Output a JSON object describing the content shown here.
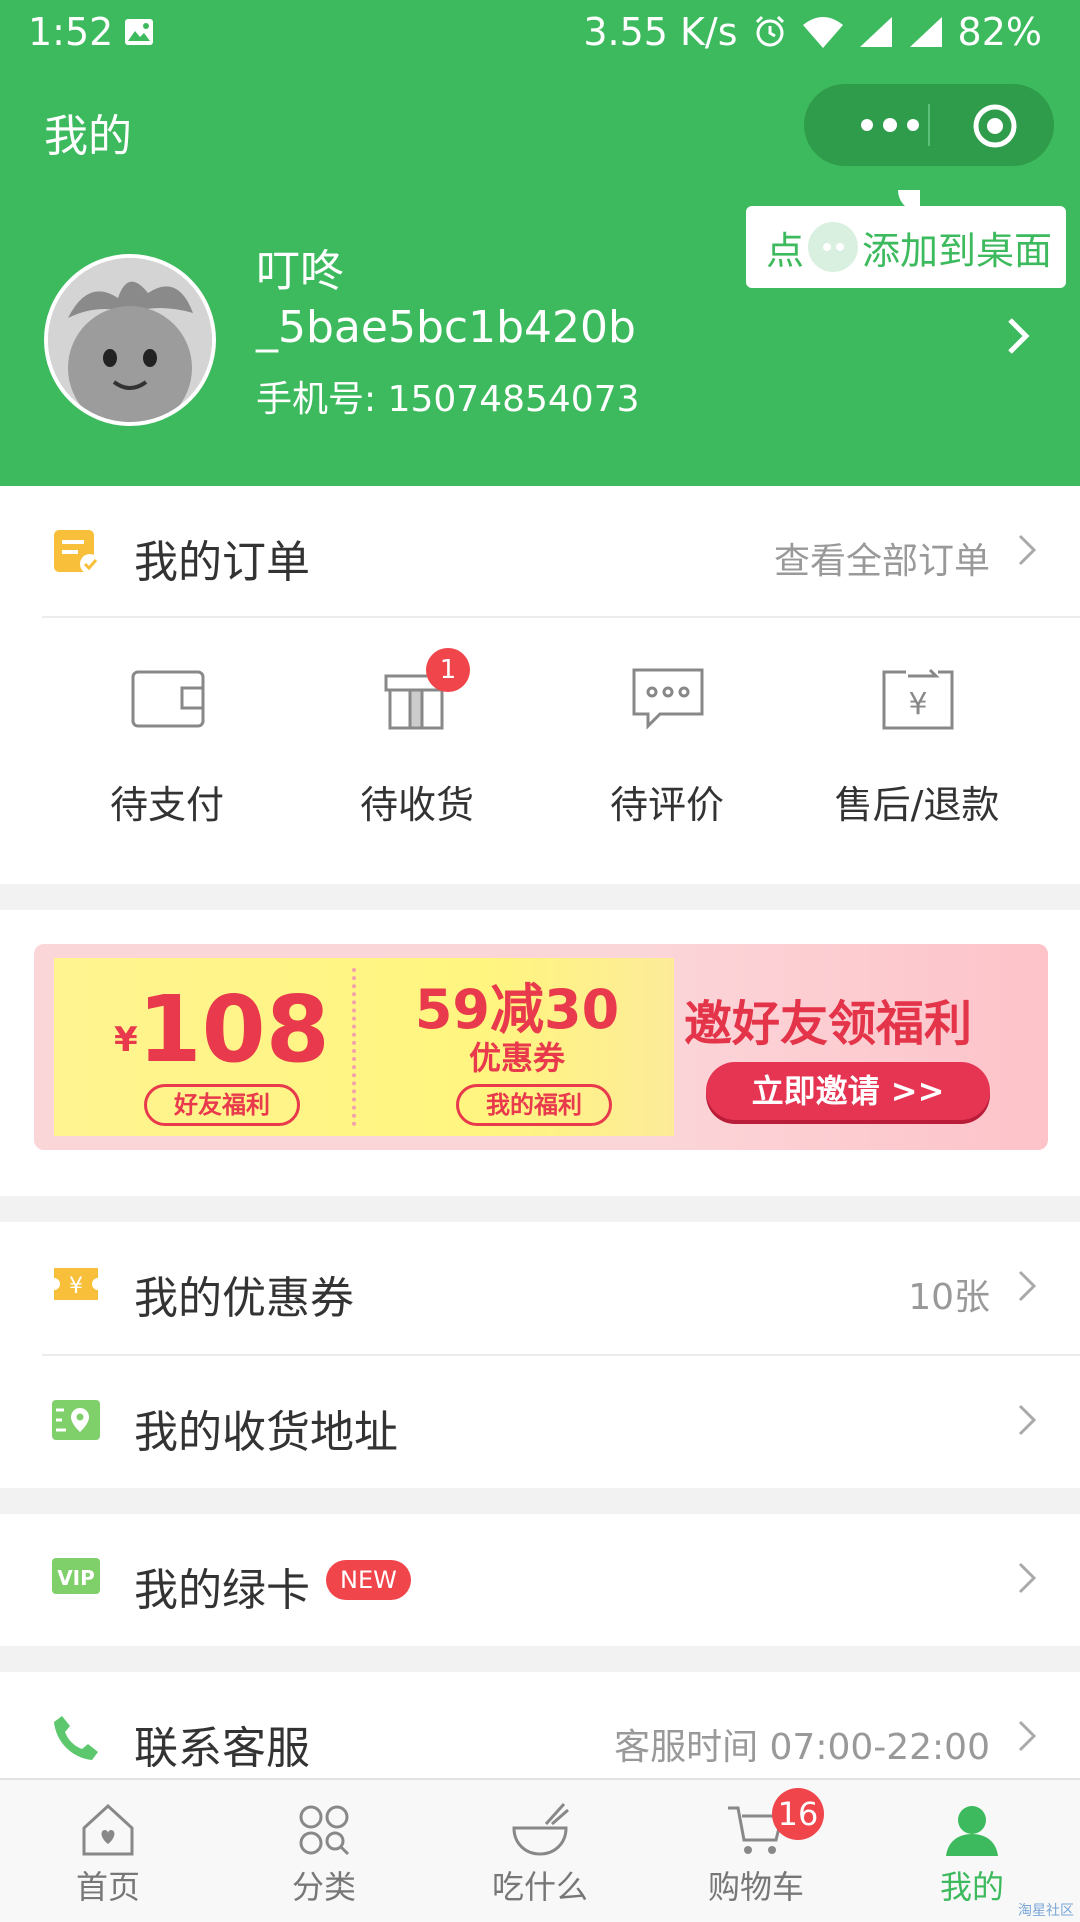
{
  "status_bar": {
    "time": "1:52",
    "net_speed": "3.55 K/s",
    "battery": "82%"
  },
  "header": {
    "title": "我的",
    "tip": {
      "prefix": "点",
      "suffix": "添加到桌面"
    },
    "user": {
      "name_line1": "叮咚",
      "name_line2": "_5bae5bc1b420b",
      "phone": "手机号: 15074854073"
    }
  },
  "orders": {
    "title": "我的订单",
    "view_all": "查看全部订单",
    "items": [
      {
        "label": "待支付",
        "icon": "wallet-icon"
      },
      {
        "label": "待收货",
        "icon": "package-icon",
        "badge": "1"
      },
      {
        "label": "待评价",
        "icon": "comment-icon"
      },
      {
        "label": "售后/退款",
        "icon": "refund-icon"
      }
    ]
  },
  "banner": {
    "amount_symbol": "¥",
    "amount": "108",
    "amount_tag": "好友福利",
    "deal_big": "59减30",
    "deal_small": "优惠券",
    "deal_tag": "我的福利",
    "invite_title": "邀好友领福利",
    "invite_button": "立即邀请 >>"
  },
  "menu": {
    "coupons": {
      "label": "我的优惠券",
      "value": "10张"
    },
    "address": {
      "label": "我的收货地址"
    },
    "greencard": {
      "label": "我的绿卡",
      "tag": "NEW"
    },
    "service": {
      "label": "联系客服",
      "value": "客服时间 07:00-22:00"
    }
  },
  "tabbar": [
    {
      "label": "首页",
      "icon": "home-icon"
    },
    {
      "label": "分类",
      "icon": "category-icon"
    },
    {
      "label": "吃什么",
      "icon": "bowl-icon"
    },
    {
      "label": "购物车",
      "icon": "cart-icon",
      "badge": "16"
    },
    {
      "label": "我的",
      "icon": "user-icon",
      "active": true
    }
  ],
  "watermark": "淘星社区",
  "colors": {
    "brand_green": "#3dba5d",
    "badge_red": "#f0454a",
    "banner_red": "#e83a4c"
  }
}
